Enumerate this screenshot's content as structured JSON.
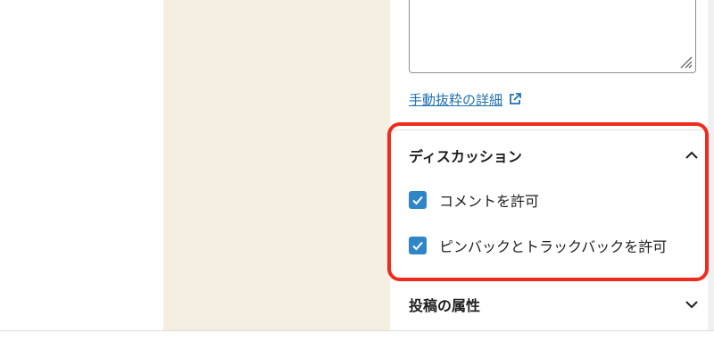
{
  "excerpt": {
    "textarea_value": "",
    "learn_more_link": "手動抜粋の詳細",
    "link_icon": "external-link-icon"
  },
  "discussion": {
    "title": "ディスカッション",
    "toggle_icon": "chevron-up-icon",
    "options": [
      {
        "label": "コメントを許可",
        "checked": true
      },
      {
        "label": "ピンバックとトラックバックを許可",
        "checked": true
      }
    ]
  },
  "attributes": {
    "title": "投稿の属性",
    "toggle_icon": "chevron-down-icon"
  },
  "colors": {
    "accent": "#2271b1",
    "checkbox": "#2e86c9",
    "highlight": "#ee2b1c",
    "canvas": "#f5efe1"
  }
}
